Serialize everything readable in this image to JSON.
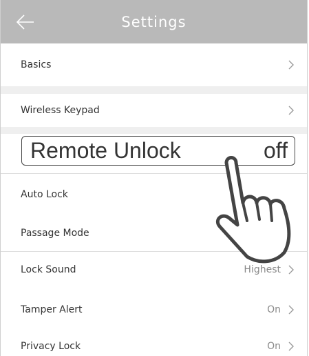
{
  "header": {
    "title": "Settings",
    "back_icon": "arrow-left-icon"
  },
  "items": {
    "basics": {
      "label": "Basics"
    },
    "wireless_keypad": {
      "label": "Wireless Keypad"
    },
    "remote_unlock": {
      "label": "Remote Unlock",
      "value": "off"
    },
    "auto_lock": {
      "label": "Auto Lock"
    },
    "passage_mode": {
      "label": "Passage Mode"
    },
    "lock_sound": {
      "label": "Lock Sound",
      "value": "Highest"
    },
    "tamper_alert": {
      "label": "Tamper Alert",
      "value": "On"
    },
    "privacy_lock": {
      "label": "Privacy Lock",
      "value": "On"
    }
  },
  "icons": {
    "chevron": "chevron-right-icon",
    "pointer": "pointing-hand-icon"
  },
  "colors": {
    "header_bg": "#b9b9b9",
    "section_gap": "#efefef",
    "text": "#333333",
    "muted": "#8a8a8a"
  }
}
